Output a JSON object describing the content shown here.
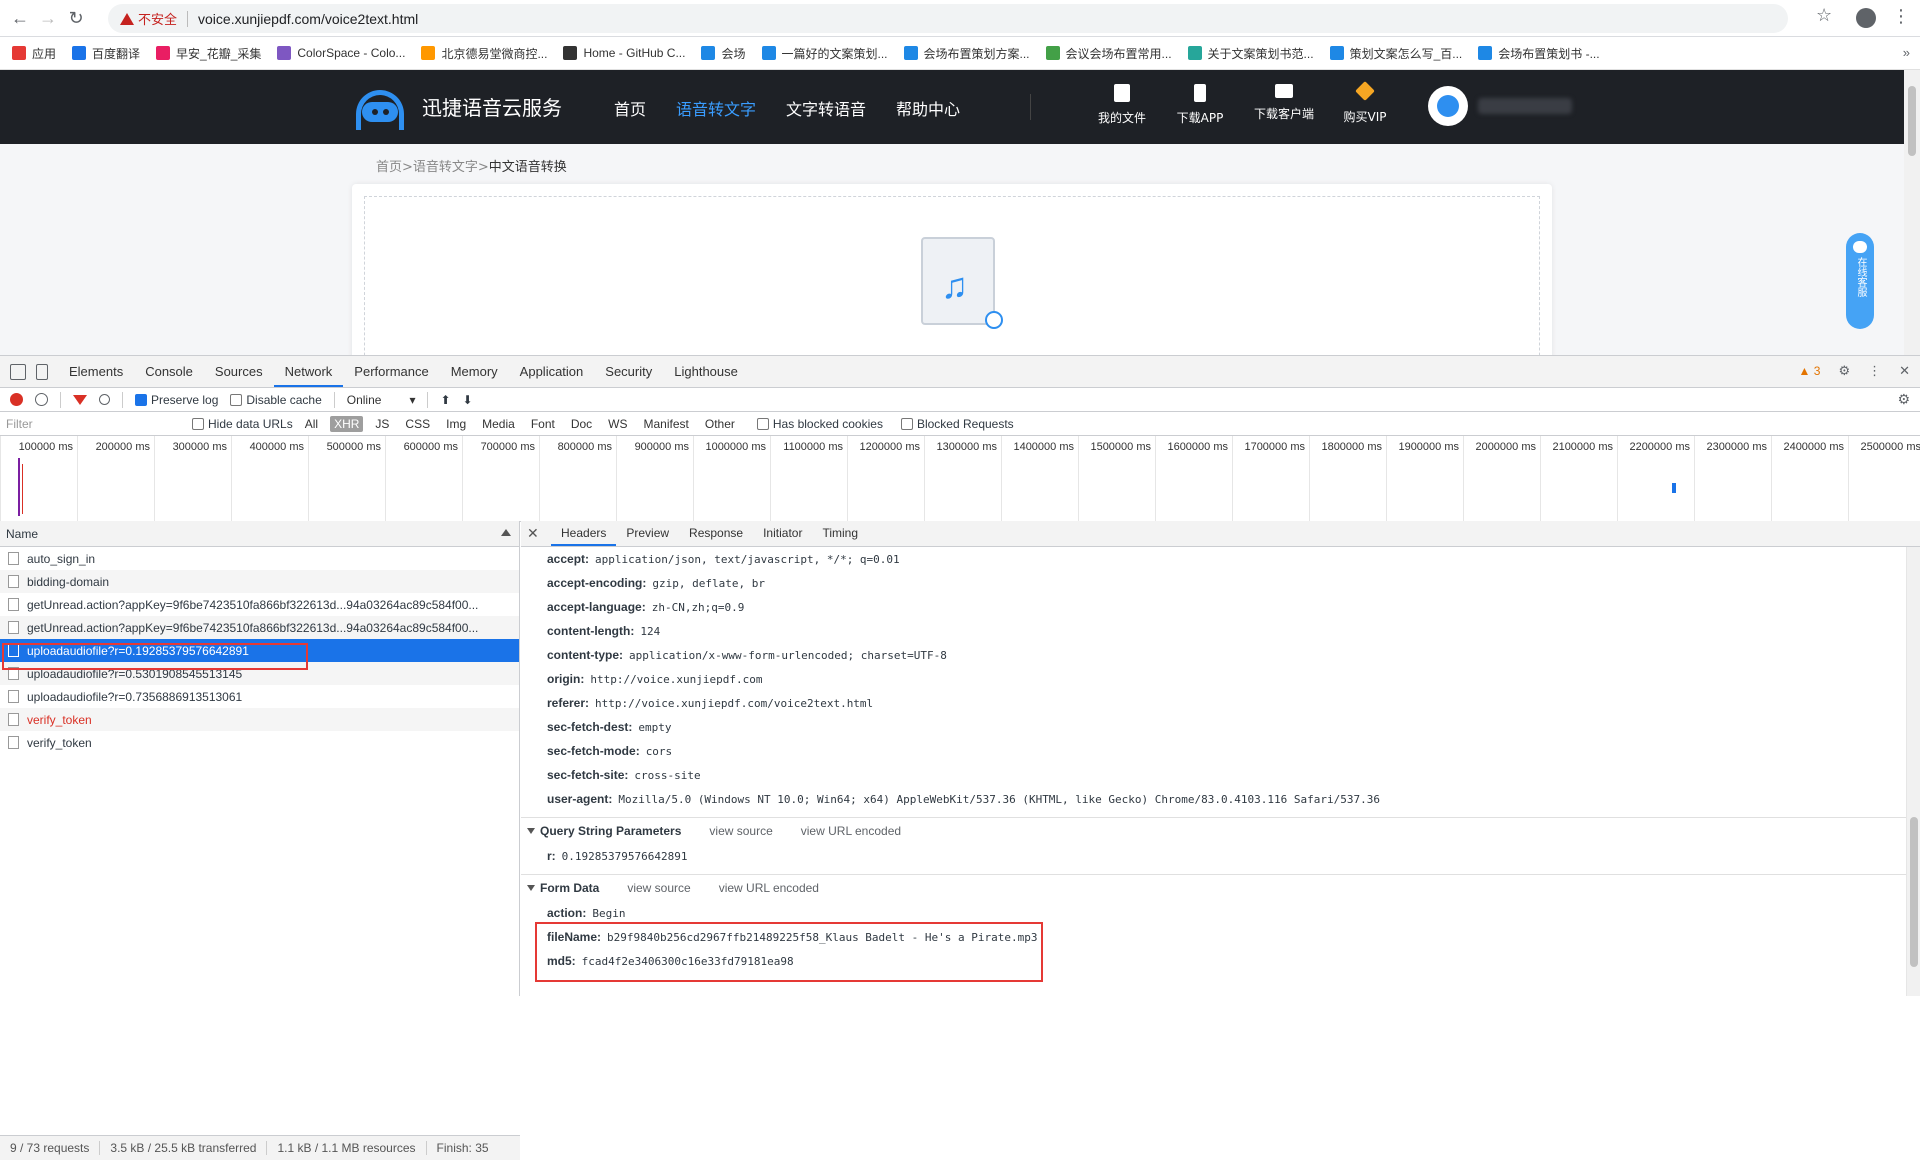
{
  "browser": {
    "security_label": "不安全",
    "url": "voice.xunjiepdf.com/voice2text.html",
    "bookmarks": [
      {
        "label": "应用",
        "color": "#e53935"
      },
      {
        "label": "百度翻译",
        "color": "#1a73e8"
      },
      {
        "label": "早安_花瓣_采集",
        "color": "#e91e63"
      },
      {
        "label": "ColorSpace - Colo...",
        "color": "#7e57c2"
      },
      {
        "label": "北京德易堂微商控...",
        "color": "#ff9800"
      },
      {
        "label": "Home - GitHub C...",
        "color": "#333333"
      },
      {
        "label": "会场",
        "color": "#1e88e5"
      },
      {
        "label": "一篇好的文案策划...",
        "color": "#1e88e5"
      },
      {
        "label": "会场布置策划方案...",
        "color": "#1e88e5"
      },
      {
        "label": "会议会场布置常用...",
        "color": "#43a047"
      },
      {
        "label": "关于文案策划书范...",
        "color": "#26a69a"
      },
      {
        "label": "策划文案怎么写_百...",
        "color": "#1e88e5"
      },
      {
        "label": "会场布置策划书 -...",
        "color": "#1e88e5"
      }
    ],
    "more_bookmarks": "»"
  },
  "site": {
    "logo_text": "迅捷语音云服务",
    "nav": [
      "首页",
      "语音转文字",
      "文字转语音",
      "帮助中心"
    ],
    "active_nav": 1,
    "tools": [
      "我的文件",
      "下载APP",
      "下载客户端",
      "购买VIP"
    ],
    "breadcrumb_prefix": "首页>语音转文字>",
    "breadcrumb_current": "中文语音转换",
    "float_service": "在线客服"
  },
  "devtools": {
    "tabs": [
      "Elements",
      "Console",
      "Sources",
      "Network",
      "Performance",
      "Memory",
      "Application",
      "Security",
      "Lighthouse"
    ],
    "active_tab": "Network",
    "warning_count": "3",
    "toolbar": {
      "preserve_log": "Preserve log",
      "disable_cache": "Disable cache",
      "throttle": "Online"
    },
    "filter": {
      "placeholder": "Filter",
      "hide_data_urls": "Hide data URLs",
      "types": [
        "All",
        "XHR",
        "JS",
        "CSS",
        "Img",
        "Media",
        "Font",
        "Doc",
        "WS",
        "Manifest",
        "Other"
      ],
      "active_type": "XHR",
      "has_blocked_cookies": "Has blocked cookies",
      "blocked_requests": "Blocked Requests"
    },
    "timeline_ticks": [
      "100000 ms",
      "200000 ms",
      "300000 ms",
      "400000 ms",
      "500000 ms",
      "600000 ms",
      "700000 ms",
      "800000 ms",
      "900000 ms",
      "1000000 ms",
      "1100000 ms",
      "1200000 ms",
      "1300000 ms",
      "1400000 ms",
      "1500000 ms",
      "1600000 ms",
      "1700000 ms",
      "1800000 ms",
      "1900000 ms",
      "2000000 ms",
      "2100000 ms",
      "2200000 ms",
      "2300000 ms",
      "2400000 ms",
      "2500000 ms"
    ],
    "name_header": "Name",
    "requests": [
      {
        "name": "auto_sign_in",
        "state": "normal"
      },
      {
        "name": "bidding-domain",
        "state": "normal"
      },
      {
        "name": "getUnread.action?appKey=9f6be7423510fa866bf322613d...94a03264ac89c584f00...",
        "state": "normal"
      },
      {
        "name": "getUnread.action?appKey=9f6be7423510fa866bf322613d...94a03264ac89c584f00...",
        "state": "normal"
      },
      {
        "name": "uploadaudiofile?r=0.19285379576642891",
        "state": "selected"
      },
      {
        "name": "uploadaudiofile?r=0.5301908545513145",
        "state": "normal"
      },
      {
        "name": "uploadaudiofile?r=0.7356886913513061",
        "state": "normal"
      },
      {
        "name": "verify_token",
        "state": "error"
      },
      {
        "name": "verify_token",
        "state": "normal"
      }
    ],
    "status": {
      "requests": "9 / 73 requests",
      "transferred": "3.5 kB / 25.5 kB transferred",
      "resources": "1.1 kB / 1.1 MB resources",
      "finish": "Finish: 35"
    },
    "detail_tabs": [
      "Headers",
      "Preview",
      "Response",
      "Initiator",
      "Timing"
    ],
    "active_detail_tab": "Headers",
    "request_headers": [
      {
        "k": "accept:",
        "v": "application/json, text/javascript, */*; q=0.01"
      },
      {
        "k": "accept-encoding:",
        "v": "gzip, deflate, br"
      },
      {
        "k": "accept-language:",
        "v": "zh-CN,zh;q=0.9"
      },
      {
        "k": "content-length:",
        "v": "124"
      },
      {
        "k": "content-type:",
        "v": "application/x-www-form-urlencoded; charset=UTF-8"
      },
      {
        "k": "origin:",
        "v": "http://voice.xunjiepdf.com"
      },
      {
        "k": "referer:",
        "v": "http://voice.xunjiepdf.com/voice2text.html"
      },
      {
        "k": "sec-fetch-dest:",
        "v": "empty"
      },
      {
        "k": "sec-fetch-mode:",
        "v": "cors"
      },
      {
        "k": "sec-fetch-site:",
        "v": "cross-site"
      },
      {
        "k": "user-agent:",
        "v": "Mozilla/5.0 (Windows NT 10.0; Win64; x64) AppleWebKit/537.36 (KHTML, like Gecko) Chrome/83.0.4103.116 Safari/537.36"
      }
    ],
    "query_section": {
      "title": "Query String Parameters",
      "view_source": "view source",
      "view_url_encoded": "view URL encoded",
      "params": [
        {
          "k": "r:",
          "v": "0.19285379576642891"
        }
      ]
    },
    "form_section": {
      "title": "Form Data",
      "view_source": "view source",
      "view_url_encoded": "view URL encoded",
      "params": [
        {
          "k": "action:",
          "v": "Begin"
        },
        {
          "k": "fileName:",
          "v": "b29f9840b256cd2967ffb21489225f58_Klaus Badelt - He's a Pirate.mp3"
        },
        {
          "k": "md5:",
          "v": "fcad4f2e3406300c16e33fd79181ea98"
        }
      ]
    },
    "highlight_color": "#e53935",
    "accent_color": "#1a73e8"
  }
}
